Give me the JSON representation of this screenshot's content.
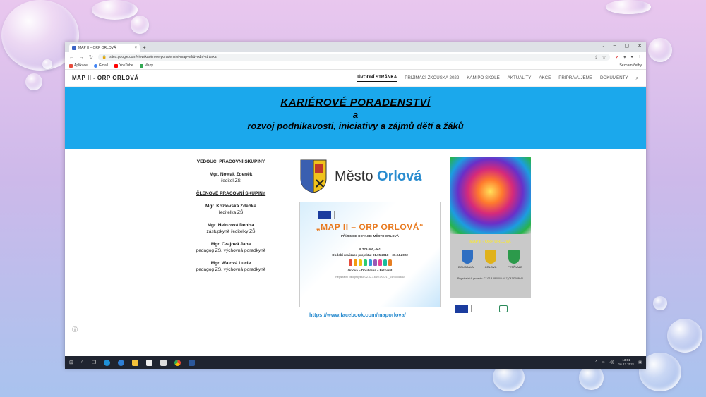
{
  "browser": {
    "tab_title": "MAP II – ORP ORLOVÁ",
    "new_tab": "+",
    "url": "sites.google.com/view/kariérove-poradenstvi-map-orl/úvodní-stránka",
    "bookmarks": [
      {
        "label": "Aplikace",
        "icon": "apps-grid-icon",
        "color": "#e74c3c"
      },
      {
        "label": "Gmail",
        "icon": "google-icon",
        "color": "#4285f4"
      },
      {
        "label": "YouTube",
        "icon": "youtube-icon",
        "color": "#ff0000"
      },
      {
        "label": "Mapy",
        "icon": "maps-icon",
        "color": "#34a853"
      }
    ],
    "reading_list": "Seznam četby"
  },
  "site": {
    "title": "MAP II - ORP ORLOVÁ",
    "nav": [
      {
        "label": "ÚVODNÍ STRÁNKA",
        "active": true
      },
      {
        "label": "PŘIJÍMACÍ ZKOUŠKA 2022"
      },
      {
        "label": "KAM PO ŠKOLE"
      },
      {
        "label": "AKTUALITY"
      },
      {
        "label": "AKCE"
      },
      {
        "label": "PŘIPRAVUJEME"
      },
      {
        "label": "DOKUMENTY"
      }
    ]
  },
  "hero": {
    "line1": "KARIÉROVÉ PORADENSTVÍ",
    "line2": "a",
    "line3": "rozvoj podnikavosti, iniciativy a zájmů dětí a žáků",
    "color": "#1ba8ec"
  },
  "people": {
    "leader_heading": "VEDOUCÍ PRACOVNÍ SKUPINY",
    "leader": {
      "name": "Mgr. Nowak Zdeněk",
      "role": "ředitel ZŠ"
    },
    "members_heading": "ČLENOVÉ PRACOVNÍ SKUPINY",
    "members": [
      {
        "name": "Mgr. Kozlovská Zdeňka",
        "role": "ředitelka ZŠ"
      },
      {
        "name": "Mgr. Heinzová Denisa",
        "role": "zástupkyně ředitelky ZŠ"
      },
      {
        "name": "Mgr. Czajová Jana",
        "role": "pedagog ZŠ, výchovná poradkyně"
      },
      {
        "name": "Mgr. Walová Lucie",
        "role": "pedagog ZŠ, výchovná poradkyně"
      }
    ]
  },
  "city_logo": {
    "prefix": "Město ",
    "name": "Orlová"
  },
  "poster": {
    "title": "„MAP II – ORP ORLOVÁ“",
    "recipient": "PŘÍJEMCE DOTACE: MĚSTO ORLOVÁ",
    "amount": "9 779 000,- Kč",
    "period": "Období realizace projektu: 01.05.2018 – 30.04.2022",
    "towns": "Orlová – Doubrava – Petřvald",
    "reg": "Registrační číslo projektu: CZ.02.3.68/0.0/0.0/17_047/0008640"
  },
  "facebook_link": "https://www.facebook.com/maporlova/",
  "banner": {
    "title": "MAP II - ORP ORLOVÁ",
    "towns": [
      "DOUBRAVA",
      "ORLOVÁ",
      "PETŘVALD"
    ],
    "reg": "Registrační č. projektu: CZ.02.3.68/0.0/0.0/17_047/0008640"
  },
  "taskbar": {
    "time": "13:01",
    "date": "16.12.2021"
  }
}
